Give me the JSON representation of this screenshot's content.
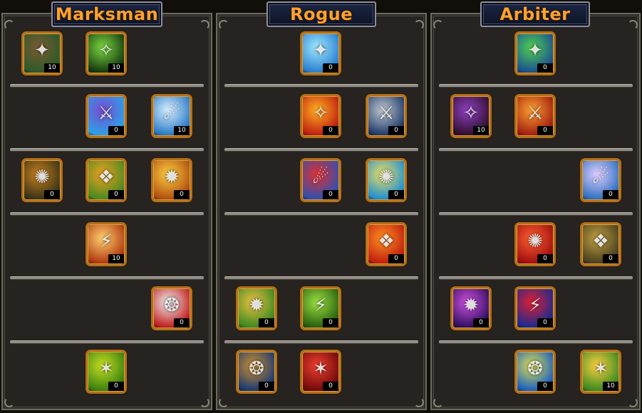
{
  "panels": [
    {
      "title": "Marksman",
      "skills": [
        {
          "icon": "bow-archer-icon",
          "level": "10",
          "c1": "#7a5a34",
          "c2": "#2d5a28"
        },
        {
          "icon": "green-web-arrows-icon",
          "level": "10",
          "c1": "#7cd840",
          "c2": "#153a10"
        },
        {
          "icon": "blue-slash-icon",
          "level": "0",
          "c1": "#7a4dd0",
          "c2": "#2aa0e8"
        },
        {
          "icon": "lightning-dice-icon",
          "level": "10",
          "c1": "#d8f0ff",
          "c2": "#2a7ac8"
        },
        {
          "icon": "hooded-ranger-icon",
          "level": "0",
          "c1": "#c8801e",
          "c2": "#3a3418"
        },
        {
          "icon": "target-burst-icon",
          "level": "0",
          "c1": "#f0a020",
          "c2": "#4a8a20"
        },
        {
          "icon": "golden-fist-icon",
          "level": "0",
          "c1": "#ffd040",
          "c2": "#b05010"
        },
        {
          "icon": "explosion-icon",
          "level": "10",
          "c1": "#ffd070",
          "c2": "#b03a10"
        },
        {
          "icon": "white-feather-icon",
          "level": "0",
          "c1": "#f0f0f0",
          "c2": "#c02020"
        },
        {
          "icon": "green-rain-icon",
          "level": "0",
          "c1": "#c8e020",
          "c2": "#3a8010"
        }
      ]
    },
    {
      "title": "Rogue",
      "skills": [
        {
          "icon": "glowing-hand-icon",
          "level": "0",
          "c1": "#a0e8ff",
          "c2": "#2a80d0"
        },
        {
          "icon": "fire-blast-icon",
          "level": "0",
          "c1": "#ffb020",
          "c2": "#c02010"
        },
        {
          "icon": "armored-knight-icon",
          "level": "0",
          "c1": "#c0c8d0",
          "c2": "#203a6a"
        },
        {
          "icon": "red-dancer-icon",
          "level": "0",
          "c1": "#e03030",
          "c2": "#3050b0"
        },
        {
          "icon": "swirl-hand-icon",
          "level": "0",
          "c1": "#f0e060",
          "c2": "#2090d0"
        },
        {
          "icon": "flaming-sword-icon",
          "level": "0",
          "c1": "#ff9020",
          "c2": "#c02010"
        },
        {
          "icon": "gold-coins-hand-icon",
          "level": "0",
          "c1": "#f0c040",
          "c2": "#3a8a20"
        },
        {
          "icon": "green-dagger-icon",
          "level": "0",
          "c1": "#9ae040",
          "c2": "#2a6010"
        },
        {
          "icon": "treasure-chest-icon",
          "level": "0",
          "c1": "#d09030",
          "c2": "#1a3a70"
        },
        {
          "icon": "red-scimitar-icon",
          "level": "0",
          "c1": "#f04030",
          "c2": "#700a0a"
        }
      ]
    },
    {
      "title": "Arbiter",
      "skills": [
        {
          "icon": "nature-orb-icon",
          "level": "0",
          "c1": "#50d050",
          "c2": "#1a5090"
        },
        {
          "icon": "dark-reaper-icon",
          "level": "10",
          "c1": "#9040c0",
          "c2": "#301030"
        },
        {
          "icon": "molten-rock-icon",
          "level": "0",
          "c1": "#ffa030",
          "c2": "#a02010"
        },
        {
          "icon": "all-seeing-hand-icon",
          "level": "0",
          "c1": "#e0d0ff",
          "c2": "#3070c0"
        },
        {
          "icon": "red-flare-icon",
          "level": "0",
          "c1": "#ff6030",
          "c2": "#a01010"
        },
        {
          "icon": "golem-fist-icon",
          "level": "0",
          "c1": "#c0a040",
          "c2": "#4a4020"
        },
        {
          "icon": "purple-chain-icon",
          "level": "0",
          "c1": "#d050e0",
          "c2": "#301060"
        },
        {
          "icon": "red-cube-icon",
          "level": "0",
          "c1": "#e02030",
          "c2": "#1a2a90"
        },
        {
          "icon": "lightning-pyramid-icon",
          "level": "0",
          "c1": "#e0e050",
          "c2": "#1a60c0"
        },
        {
          "icon": "golden-aura-hands-icon",
          "level": "10",
          "c1": "#ffd040",
          "c2": "#3a8a20"
        }
      ]
    }
  ]
}
